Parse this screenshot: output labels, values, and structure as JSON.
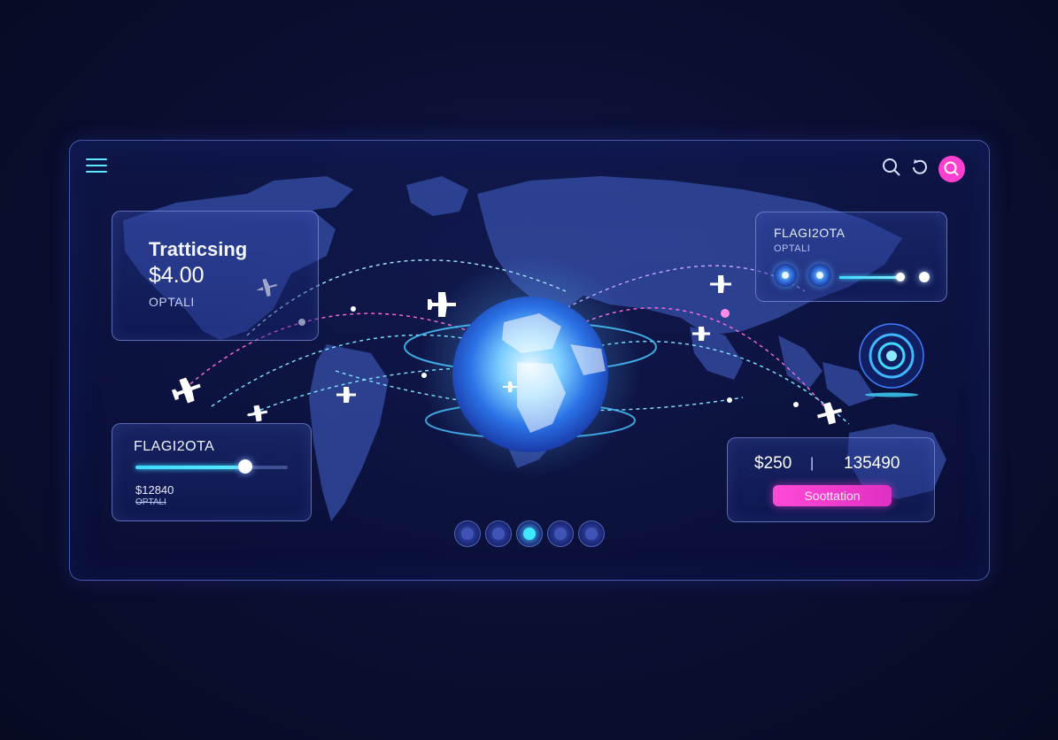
{
  "header": {
    "menu_icon": "menu-icon",
    "icons": [
      "search-icon",
      "refresh-icon",
      "search-active-icon"
    ],
    "accent": "#ff3fd0"
  },
  "panel_top_left": {
    "title": "Tratticsing",
    "price": "$4.00",
    "sub": "OPTALI"
  },
  "panel_bottom_left": {
    "title": "FLAGI2OTA",
    "price": "$12840",
    "sub": "OPTALI",
    "slider_level": 0.72
  },
  "panel_top_right": {
    "title": "FLAGI2OTA",
    "sub": "OPTALI"
  },
  "panel_bottom_right": {
    "value_left": "$250",
    "separator": "|",
    "value_right": "135490",
    "button_label": "Soottation"
  },
  "pager": {
    "pages": 5,
    "active": 3
  },
  "colors": {
    "background": "#0b1034",
    "cyan": "#3fe8ff",
    "magenta": "#ff3fd0",
    "panel_border": "#96afff"
  }
}
